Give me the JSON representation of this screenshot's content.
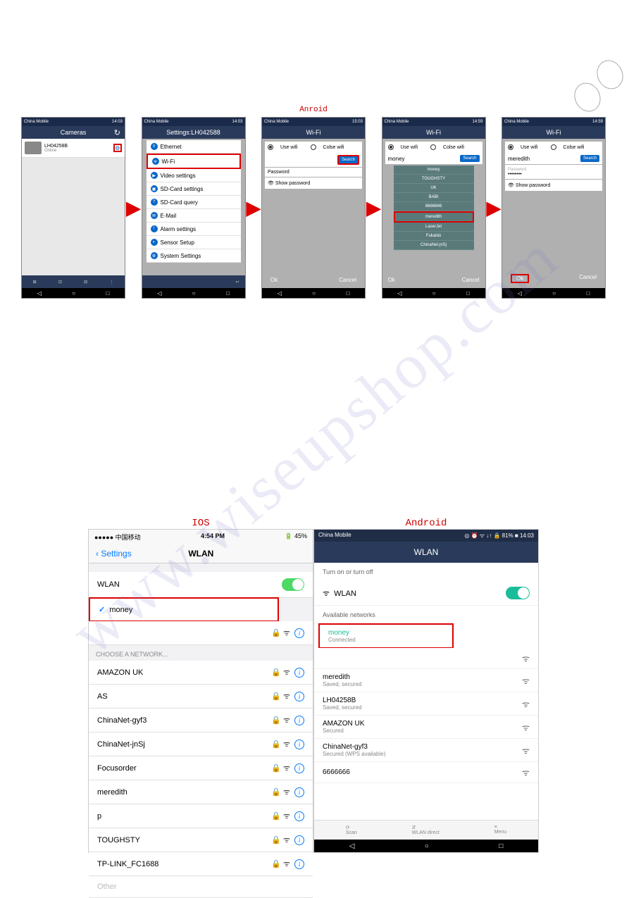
{
  "top_label": "Anroid",
  "statusbar": {
    "carrier": "China Mobile",
    "time_a": "14:03",
    "batt_a": "81%",
    "time_b": "14:59",
    "time_c": "15:03"
  },
  "nav": {
    "back": "◁",
    "home": "○",
    "recent": "□"
  },
  "p1": {
    "title": "Cameras",
    "refresh": "↻",
    "camera_name": "LH04258B",
    "camera_status": "Online",
    "settings_icon": "⚙"
  },
  "p2": {
    "title": "Settings:LH042588",
    "items": [
      "Ethernet",
      "Wi-Fi",
      "Video settings",
      "SD-Card settings",
      "SD-Card query",
      "E-Mail",
      "Alarm settings",
      "Sensor Setup",
      "System Settings"
    ]
  },
  "p3": {
    "title": "Wi-Fi",
    "opt1": "Use wifi",
    "opt2": "Colse wifi",
    "search": "Search",
    "password_label": "Password",
    "showpw": "Show password",
    "ok": "Ok",
    "cancel": "Cancel"
  },
  "p4": {
    "ssid": "money",
    "ddlist": [
      "money",
      "TOUGHSTY",
      "UK",
      "BABI",
      "6666666",
      "meredith",
      "LaserJet",
      "Fukaido",
      "ChinaNet-jnSj"
    ]
  },
  "p5": {
    "ssid": "meredith",
    "pw_dots": "••••••••"
  },
  "ios": {
    "label": "IOS",
    "carrier": "●●●●● 中国移动",
    "time": "4:54 PM",
    "batt": "45%",
    "back": "Settings",
    "title": "WLAN",
    "wlan": "WLAN",
    "connected": "money",
    "section": "CHOOSE A NETWORK...",
    "nets": [
      "AMAZON UK",
      "AS",
      "ChinaNet-gyf3",
      "ChinaNet-jnSj",
      "Focusorder",
      "meredith",
      "p",
      "TOUGHSTY",
      "TP-LINK_FC1688",
      "Other"
    ]
  },
  "and": {
    "label": "Android",
    "carrier": "China Mobile",
    "icons": "◎ ⏰ ᯤ ↓↑ 🔒 81% ■ 14:03",
    "title": "WLAN",
    "turn": "Turn on or turn off",
    "wlan": "WLAN",
    "avail": "Available networks",
    "nets": [
      {
        "name": "money",
        "sub": "Connected",
        "conn": true
      },
      {
        "name": "meredith",
        "sub": "Saved, secured"
      },
      {
        "name": "LH04258B",
        "sub": "Saved, secured"
      },
      {
        "name": "AMAZON UK",
        "sub": "Secured"
      },
      {
        "name": "ChinaNet-gyf3",
        "sub": "Secured (WPS available)"
      },
      {
        "name": "6666666",
        "sub": ""
      }
    ],
    "bot": [
      "Scan",
      "WLAN direct",
      "Menu"
    ]
  }
}
